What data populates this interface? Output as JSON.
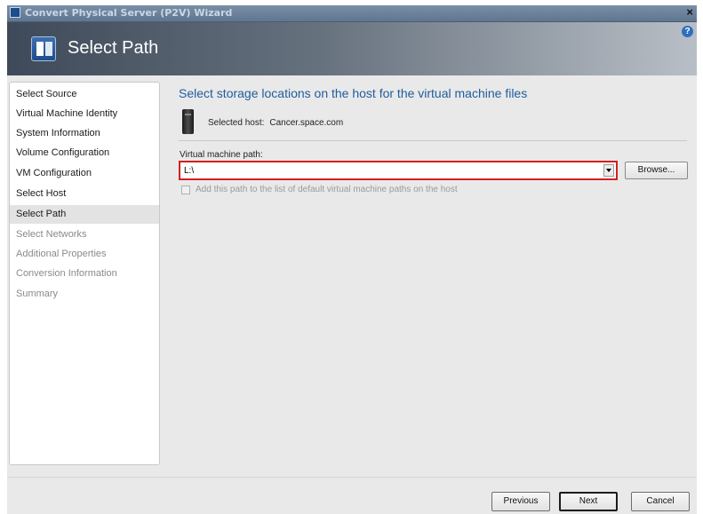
{
  "window": {
    "title": "Convert Physical Server (P2V) Wizard",
    "close_label": "×",
    "help_label": "?"
  },
  "header": {
    "title": "Select Path",
    "icon": "wizard-icon"
  },
  "nav": {
    "items": [
      {
        "label": "Select Source",
        "state": "done"
      },
      {
        "label": "Virtual Machine Identity",
        "state": "done"
      },
      {
        "label": "System Information",
        "state": "done"
      },
      {
        "label": "Volume Configuration",
        "state": "done"
      },
      {
        "label": "VM Configuration",
        "state": "done"
      },
      {
        "label": "Select Host",
        "state": "done"
      },
      {
        "label": "Select Path",
        "state": "selected"
      },
      {
        "label": "Select Networks",
        "state": "disabled"
      },
      {
        "label": "Additional Properties",
        "state": "disabled"
      },
      {
        "label": "Conversion Information",
        "state": "disabled"
      },
      {
        "label": "Summary",
        "state": "disabled"
      }
    ]
  },
  "main": {
    "heading": "Select storage locations on the host for the virtual machine files",
    "selected_host_label": "Selected host:",
    "selected_host_value": "Cancer.space.com",
    "vm_path_label": "Virtual machine path:",
    "vm_path_value": "L:\\",
    "browse_label": "Browse...",
    "add_default_path_label": "Add this path to the list of default virtual machine paths on the host",
    "add_default_path_checked": false,
    "highlight_color": "#d21f1f"
  },
  "footer": {
    "previous_label": "Previous",
    "next_label": "Next",
    "cancel_label": "Cancel"
  }
}
